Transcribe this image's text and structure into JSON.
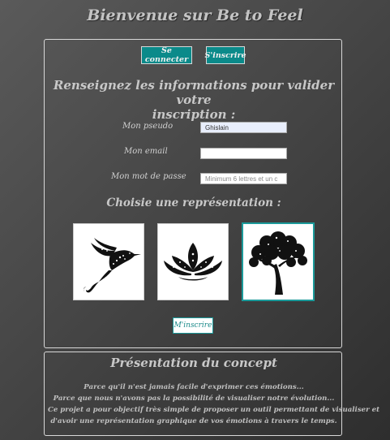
{
  "site": {
    "title": "Bienvenue sur Be to Feel"
  },
  "tabs": {
    "login": "Se connecter",
    "signup": "S'inscrire"
  },
  "form": {
    "heading_line1": "Renseignez les informations pour valider votre",
    "heading_line2": "inscription :",
    "pseudo": {
      "label": "Mon pseudo",
      "value": "Ghislain"
    },
    "email": {
      "label": "Mon email",
      "value": ""
    },
    "password": {
      "label": "Mon mot de passe",
      "placeholder": "Minimum 6 lettres et un c"
    },
    "representation_heading": "Choisie une représentation :",
    "representations": [
      {
        "icon": "hummingbird-icon",
        "selected": false
      },
      {
        "icon": "lotus-icon",
        "selected": false
      },
      {
        "icon": "tree-icon",
        "selected": true
      }
    ],
    "submit_label": "M'inscrire"
  },
  "concept": {
    "title": "Présentation du concept",
    "lines": [
      "Parce qu'il n'est jamais facile d'exprimer ces émotions...",
      "Parce que nous n'avons pas la possibilité de visualiser notre évolution...",
      "Ce projet a pour objectif très simple de proposer un outil permettant de visualiser et",
      "d'avoir une représentation graphique de vos émotions à travers le temps."
    ]
  },
  "colors": {
    "accent": "#0b8a8a",
    "panel_border": "#d8d8d8",
    "text": "#c8c8c8"
  }
}
